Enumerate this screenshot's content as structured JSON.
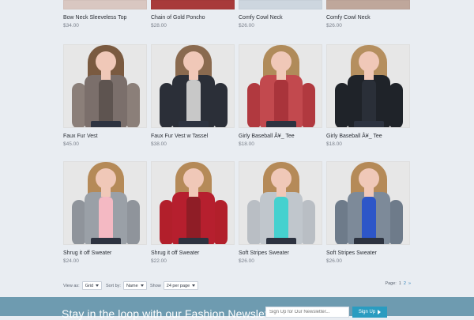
{
  "products": {
    "row1": [
      {
        "title": "Bow Neck Sleeveless Top",
        "price": "$34.00"
      },
      {
        "title": "Chain of Gold Poncho",
        "price": "$28.00"
      },
      {
        "title": "Comfy Cowl Neck",
        "price": "$26.00"
      },
      {
        "title": "Comfy Cowl Neck",
        "price": "$26.00"
      }
    ],
    "row2": [
      {
        "title": "Faux Fur Vest",
        "price": "$45.00"
      },
      {
        "title": "Faux Fur Vest w Tassel",
        "price": "$38.00"
      },
      {
        "title": "Girly Baseball Â¥_ Tee",
        "price": "$18.00"
      },
      {
        "title": "Girly Baseball Â¥_ Tee",
        "price": "$18.00"
      }
    ],
    "row3": [
      {
        "title": "Shrug it off Sweater",
        "price": "$24.00"
      },
      {
        "title": "Shrug it off Sweater",
        "price": "$22.00"
      },
      {
        "title": "Soft Stripes Sweater",
        "price": "$26.00"
      },
      {
        "title": "Soft Stripes Sweater",
        "price": "$26.00"
      }
    ]
  },
  "controls": {
    "view_label": "View as:",
    "view_value": "Grid",
    "sort_label": "Sort by:",
    "sort_value": "Name",
    "show_label": "Show",
    "show_value": "24 per page",
    "page_label": "Page:",
    "page_current": "1",
    "page_next": "2",
    "page_next_arrow": "»"
  },
  "footer": {
    "headline": "Stay in the loop with our Fashion Newsletter",
    "input_placeholder": "Sign Up for Our Newsletter...",
    "button_label": "Sign Up"
  },
  "colors": {
    "background": "#e9edf2",
    "footer_bar": "#6e9bb0",
    "signup_button": "#2a9cc0",
    "link": "#2e7fb8"
  }
}
